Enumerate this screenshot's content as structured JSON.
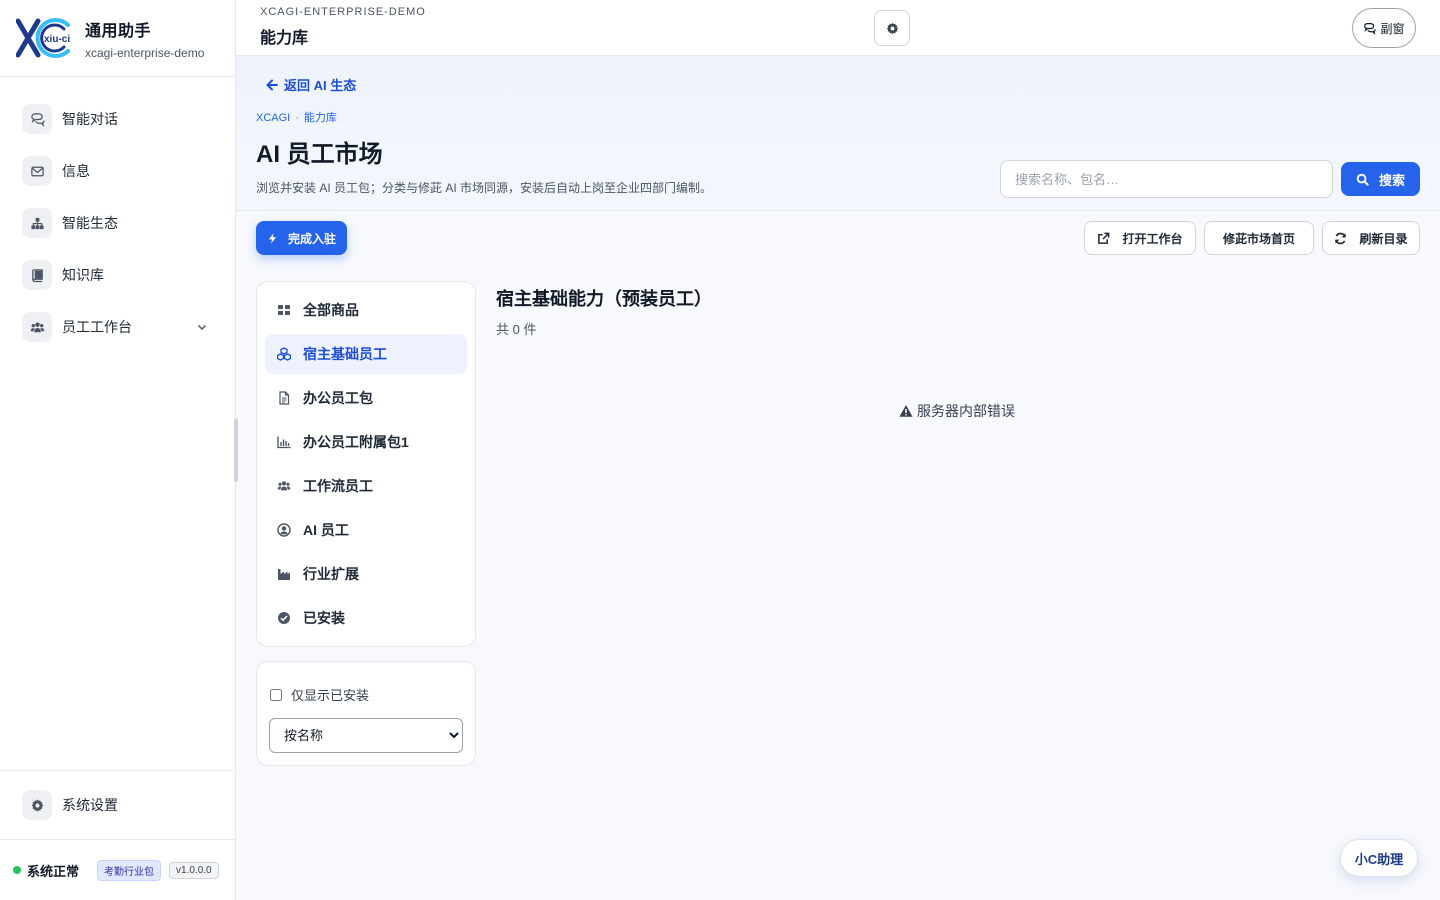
{
  "brand": {
    "title": "通用助手",
    "subtitle": "xcagi-enterprise-demo",
    "logo_text": "xiu-ci"
  },
  "sidebar": {
    "items": [
      {
        "label": "智能对话",
        "icon": "chat-icon"
      },
      {
        "label": "信息",
        "icon": "mail-icon"
      },
      {
        "label": "智能生态",
        "icon": "sitemap-icon"
      },
      {
        "label": "知识库",
        "icon": "book-icon"
      },
      {
        "label": "员工工作台",
        "icon": "users-icon"
      }
    ],
    "settings_label": "系统设置"
  },
  "status": {
    "text": "系统正常",
    "pack_badge": "考勤行业包",
    "version": "v1.0.0.0",
    "color": "#22c55e"
  },
  "topbar": {
    "workspace": "XCAGI-ENTERPRISE-DEMO",
    "title": "能力库",
    "side_window_label": "副窗"
  },
  "header": {
    "back_label": "返回 AI 生态",
    "breadcrumb": [
      "XCAGI",
      "能力库"
    ],
    "title": "AI 员工市场",
    "description": "浏览并安装 AI 员工包；分类与修茈 AI 市场同源，安装后自动上岗至企业四部门编制。",
    "search_placeholder": "搜索名称、包名…",
    "search_label": "搜索"
  },
  "actions": {
    "onboard_label": "完成入驻",
    "open_workbench_label": "打开工作台",
    "market_home_label": "修茈市场首页",
    "refresh_label": "刷新目录"
  },
  "categories": [
    {
      "label": "全部商品",
      "icon": "grid-icon",
      "active": false
    },
    {
      "label": "宿主基础员工",
      "icon": "cubes-icon",
      "active": true
    },
    {
      "label": "办公员工包",
      "icon": "document-icon",
      "active": false
    },
    {
      "label": "办公员工附属包1",
      "icon": "bar-chart-icon",
      "active": false
    },
    {
      "label": "工作流员工",
      "icon": "users-icon",
      "active": false
    },
    {
      "label": "AI 员工",
      "icon": "user-circle-icon",
      "active": false
    },
    {
      "label": "行业扩展",
      "icon": "industry-icon",
      "active": false
    },
    {
      "label": "已安装",
      "icon": "check-circle-icon",
      "active": false
    }
  ],
  "filters": {
    "installed_only_label": "仅显示已安装",
    "installed_only_checked": false,
    "sort_value": "按名称"
  },
  "main": {
    "section_title": "宿主基础能力（预装员工）",
    "count_text": "共 0 件",
    "error_text": "服务器内部错误"
  },
  "assistant_label": "小C助理",
  "colors": {
    "accent": "#2563eb",
    "accent_dark": "#1d4ed8",
    "active_bg": "#eef2ff"
  }
}
